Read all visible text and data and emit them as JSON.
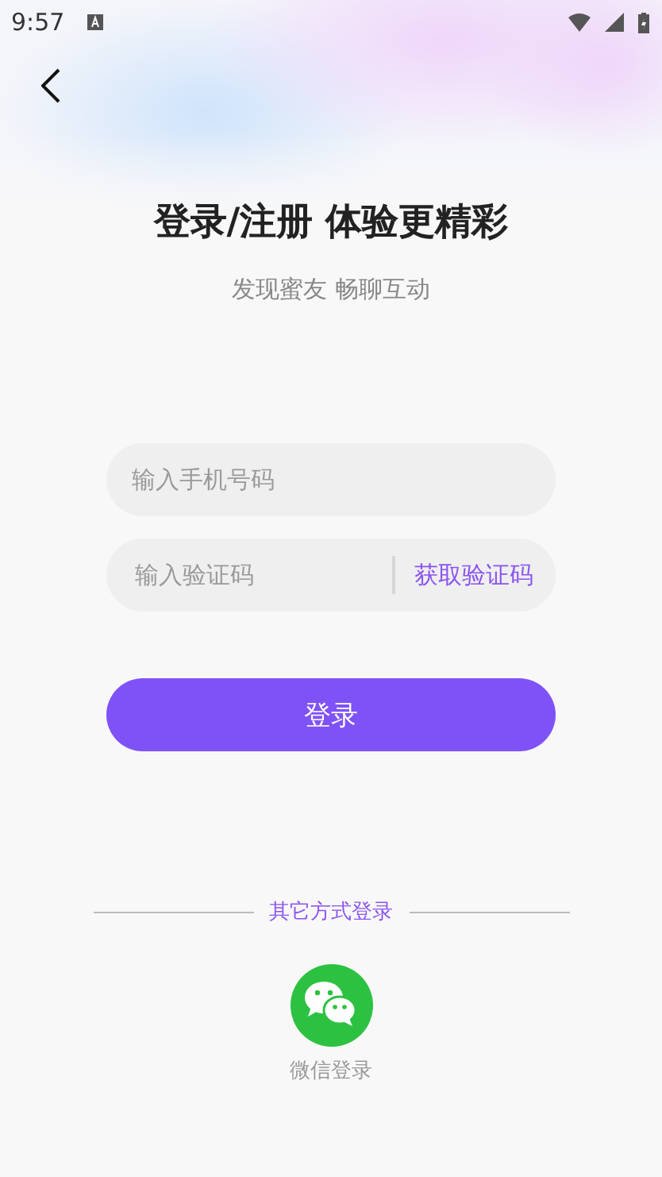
{
  "status_bar": {
    "time": "9:57"
  },
  "title": "登录/注册 体验更精彩",
  "subtitle": "发现蜜友 畅聊互动",
  "phone_field": {
    "placeholder": "输入手机号码"
  },
  "code_field": {
    "placeholder": "输入验证码",
    "action": "获取验证码"
  },
  "login_button": "登录",
  "other_methods": {
    "label": "其它方式登录",
    "items": [
      {
        "kind": "wechat",
        "label": "微信登录"
      }
    ]
  }
}
